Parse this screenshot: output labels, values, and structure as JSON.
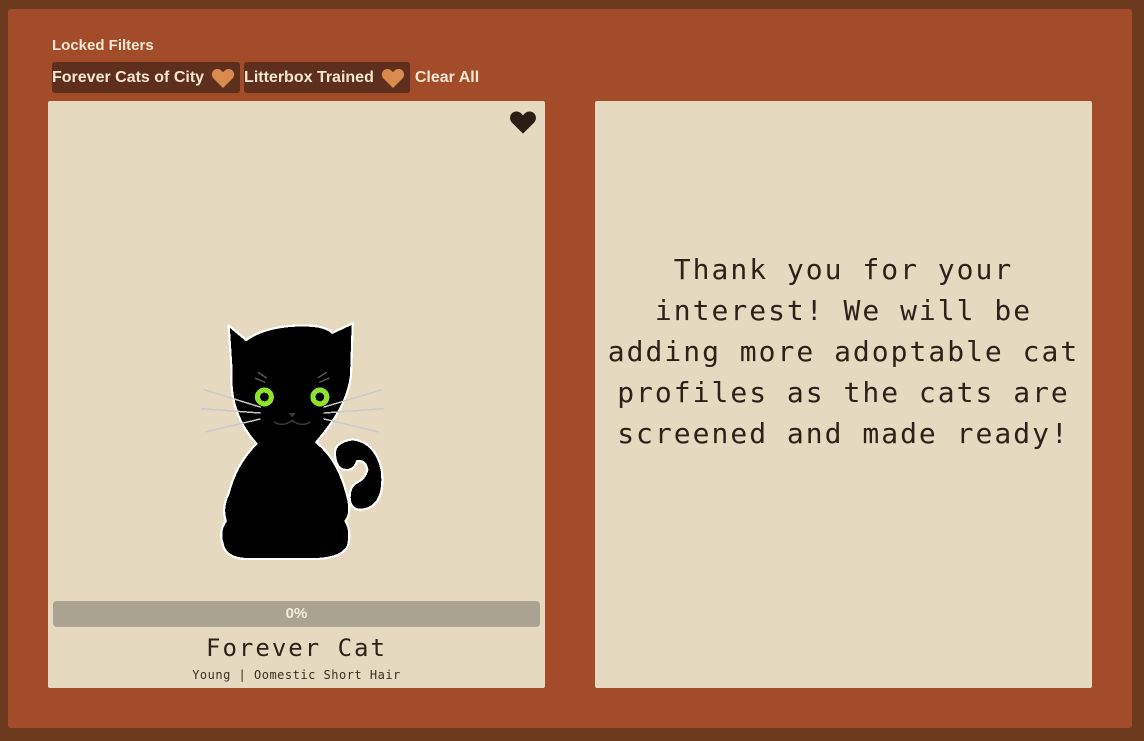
{
  "filters": {
    "title": "Locked Filters",
    "chips": [
      {
        "label": "Forever Cats of City",
        "icon": "heart-icon"
      },
      {
        "label": "Litterbox Trained",
        "icon": "heart-icon"
      }
    ],
    "clear_label": "Clear All"
  },
  "card": {
    "favorite_icon": "heart-icon",
    "image_icon": "black-cat-icon",
    "progress_percent": 0,
    "progress_label": "0%",
    "name": "Forever Cat",
    "meta": "Young | Oomestic Short Hair"
  },
  "panel": {
    "message": "Thank you for your interest! We will be adding more adoptable cat profiles as the cats are screened and made ready!"
  },
  "colors": {
    "background": "#6b3a1f",
    "frame": "#a24c29",
    "card": "#e5d9bf",
    "chip": "#5e2f1c",
    "chip_heart": "#d98b4f",
    "favorite_heart": "#2b1d14",
    "progress_track": "#aaa391",
    "cat_eye": "#8ee22b"
  }
}
